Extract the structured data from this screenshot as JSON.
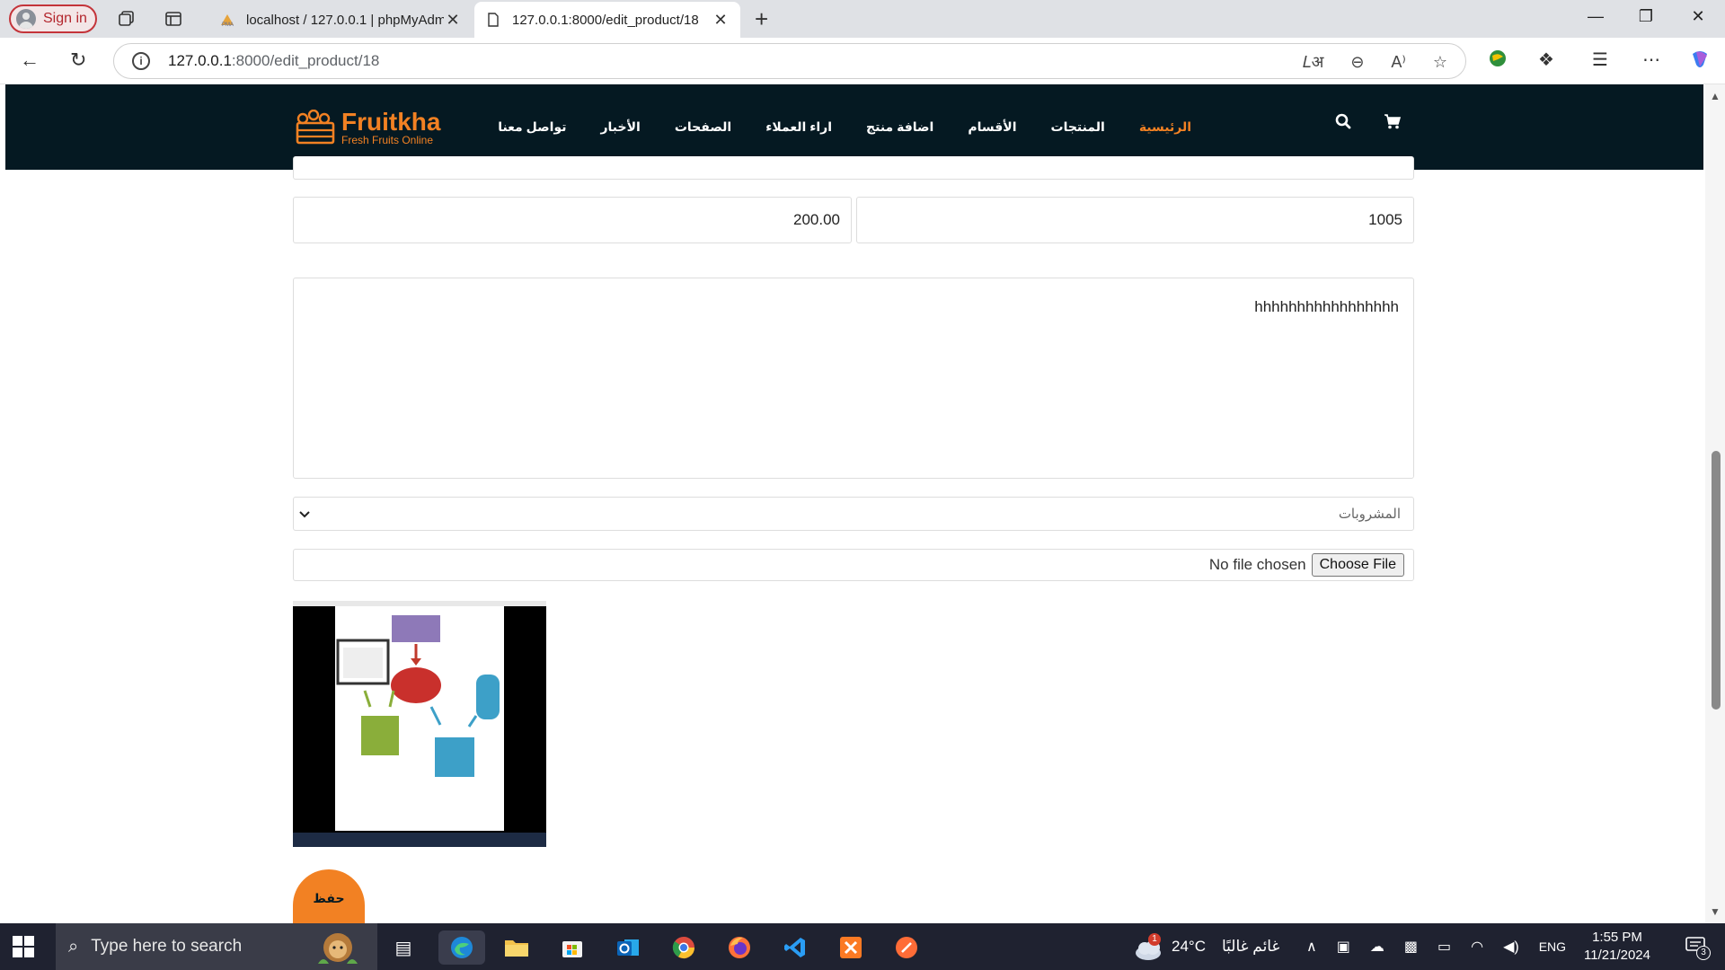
{
  "browser": {
    "signin_label": "Sign in",
    "tabs": [
      {
        "title": "localhost / 127.0.0.1 | phpMyAdm",
        "close": "✕"
      },
      {
        "title": "127.0.0.1:8000/edit_product/18",
        "close": "✕"
      }
    ],
    "new_tab": "+",
    "url_host": "127.0.0.1",
    "url_path": ":8000/edit_product/18"
  },
  "site": {
    "logo_name": "Fruitkha",
    "logo_tagline": "Fresh Fruits Online",
    "menu": [
      {
        "label": "الرئيسية",
        "active": true
      },
      {
        "label": "المنتجات"
      },
      {
        "label": "الأقسام"
      },
      {
        "label": "اضافة منتج"
      },
      {
        "label": "اراء العملاء"
      },
      {
        "label": "الصفحات"
      },
      {
        "label": "الأخبار"
      },
      {
        "label": "تواصل معنا"
      }
    ],
    "accent_color": "#f28123",
    "header_bg": "#051922"
  },
  "form": {
    "price_value": "200.00",
    "quantity_value": "1005",
    "description_value": "hhhhhhhhhhhhhhhhh",
    "category_selected": "المشروبات",
    "file_status": "No file chosen",
    "file_button": "Choose File",
    "save_label": "حفظ"
  },
  "taskbar": {
    "search_placeholder": "Type here to search",
    "weather_temp": "24°C",
    "weather_text": "غائم غالبًا",
    "weather_badge": "1",
    "language": "ENG",
    "time": "1:55 PM",
    "date": "11/21/2024",
    "notification_count": "3"
  }
}
